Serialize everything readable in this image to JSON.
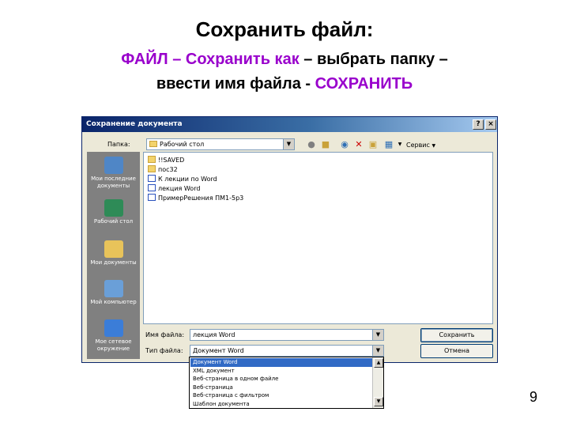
{
  "slide": {
    "title": "Сохранить файл:",
    "line1_purple": "ФАЙЛ – Сохранить как",
    "line1_black": " – выбрать папку –",
    "line2_black": "ввести имя файла - ",
    "line2_purple": "СОХРАНИТЬ",
    "page_number": "9"
  },
  "dialog": {
    "title": "Сохранение документа",
    "help_glyph": "?",
    "close_glyph": "×",
    "folder_label": "Папка:",
    "folder_value": "Рабочий стол",
    "tools_label": "Сервис",
    "places": [
      {
        "label": "Мои последние документы",
        "icon": "recent-documents-icon",
        "color": "#4f86c6"
      },
      {
        "label": "Рабочий стол",
        "icon": "desktop-icon",
        "color": "#2e8b57"
      },
      {
        "label": "Мои документы",
        "icon": "my-documents-icon",
        "color": "#e8c35a"
      },
      {
        "label": "Мой компьютер",
        "icon": "my-computer-icon",
        "color": "#6a9fd8"
      },
      {
        "label": "Мое сетевое окружение",
        "icon": "network-icon",
        "color": "#3b7dd8"
      }
    ],
    "files": [
      {
        "name": "!!SAVED",
        "type": "folder"
      },
      {
        "name": "пос32",
        "type": "folder"
      },
      {
        "name": "К лекции по Word",
        "type": "doc"
      },
      {
        "name": "лекция Word",
        "type": "doc"
      },
      {
        "name": "ПримерРешения ПМ1-5р3",
        "type": "doc"
      }
    ],
    "filename_label": "Имя файла:",
    "filename_value": "лекция Word",
    "filetype_label": "Тип файла:",
    "filetype_value": "Документ Word",
    "save_button": "Сохранить",
    "cancel_button": "Отмена"
  },
  "dropdown_options": [
    "Документ Word",
    "XML документ",
    "Веб-страница в одном файле",
    "Веб-страница",
    "Веб-страница с фильтром",
    "Шаблон документа"
  ]
}
